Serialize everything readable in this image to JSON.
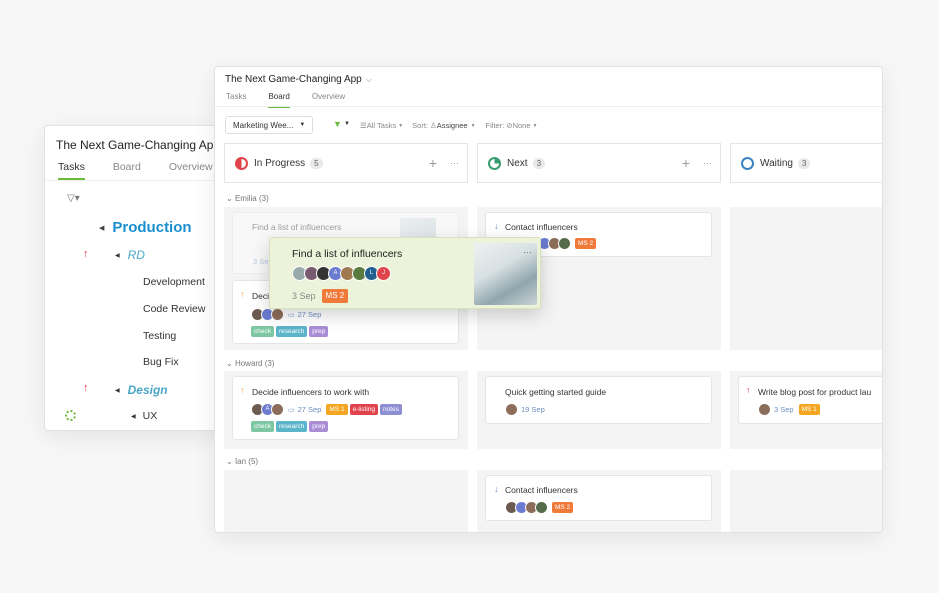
{
  "back": {
    "title": "The Next Game-Changing Ap",
    "tabs": [
      "Tasks",
      "Board",
      "Overview"
    ],
    "tree": {
      "production": "Production",
      "rd": "RD",
      "rd_items": [
        "Development",
        "Code Review",
        "Testing",
        "Bug Fix"
      ],
      "design": "Design",
      "ux": "UX"
    }
  },
  "front": {
    "title": "The Next Game-Changing App",
    "tabs": [
      "Tasks",
      "Board",
      "Overview"
    ],
    "toolbar": {
      "view": "Marketing Wee...",
      "all_tasks": "All Tasks",
      "sort_label": "Sort:",
      "sort_value": "Assignee",
      "filter_label": "Filter:",
      "filter_value": "None"
    },
    "columns": [
      {
        "name": "In Progress",
        "count": "5"
      },
      {
        "name": "Next",
        "count": "3"
      },
      {
        "name": "Waiting",
        "count": "3"
      }
    ],
    "groups": [
      {
        "name": "Emilia",
        "count": "(3)"
      },
      {
        "name": "Howard",
        "count": "(3)"
      },
      {
        "name": "Ian",
        "count": "(5)"
      }
    ],
    "cards": {
      "emilia_ip_top": {
        "title": "Find a list of influencers",
        "date": "3 Sep"
      },
      "emilia_ip_2": {
        "title": "Deci",
        "date": "27 Sep"
      },
      "emilia_next": {
        "title": "Contact influencers",
        "tag": "MS 2"
      },
      "howard_ip": {
        "title": "Decide influencers to work with",
        "date": "27 Sep"
      },
      "howard_next": {
        "title": "Quick getting started guide",
        "date": "19 Sep"
      },
      "howard_wait": {
        "title": "Write blog post for product lau",
        "date": "3 Sep",
        "tag": "MS 1"
      },
      "ian_next": {
        "title": "Contact influencers",
        "tag": "MS 2"
      }
    },
    "tags": {
      "ms1": "MS 1",
      "elisting": "e-listing",
      "notes": "notes",
      "check": "check",
      "research": "research",
      "prep": "prep"
    },
    "drag": {
      "title": "Find a list of influencers",
      "date": "3 Sep",
      "tag": "MS 2",
      "avatars": [
        "A",
        "L",
        "J"
      ]
    }
  },
  "colors": {
    "accent": "#6cba3c",
    "ms": "#f5a623",
    "ms2": "#f07a3a",
    "elisting": "#e0434b",
    "notes": "#8e8ed4",
    "check": "#7ec7a3",
    "research": "#5bb4c9",
    "prep": "#a98ed6",
    "production": "#1a8fcf",
    "drag_bg": "#ecf3da"
  }
}
